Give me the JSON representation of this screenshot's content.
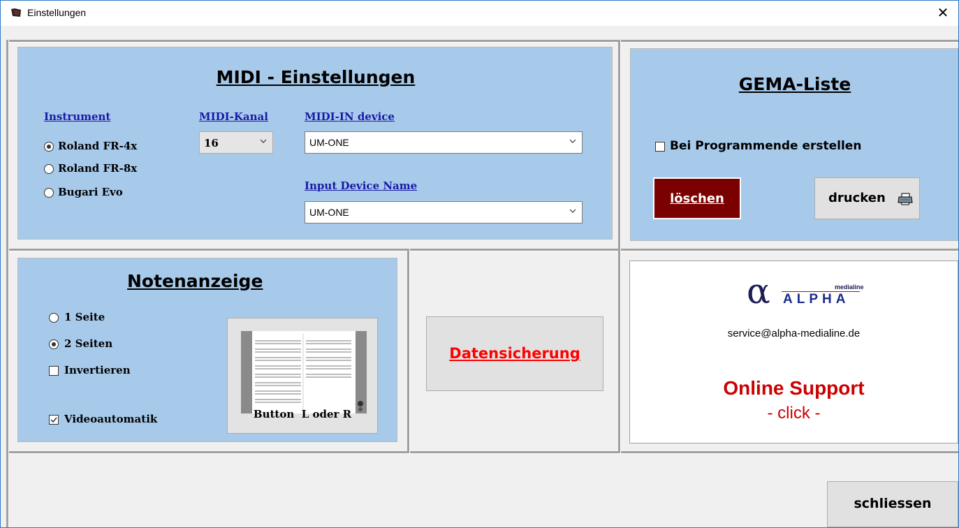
{
  "window": {
    "title": "Einstellungen",
    "close_glyph": "✕"
  },
  "midi": {
    "title": "MIDI - Einstellungen",
    "instrument_label": "Instrument",
    "instruments": [
      {
        "label": "Roland FR-4x",
        "selected": true
      },
      {
        "label": "Roland FR-8x",
        "selected": false
      },
      {
        "label": "Bugari Evo",
        "selected": false
      }
    ],
    "kanal_label": "MIDI-Kanal",
    "kanal_value": "16",
    "in_device_label": "MIDI-IN device",
    "in_device_value": "UM-ONE",
    "input_name_label": "Input Device Name",
    "input_name_value": "UM-ONE"
  },
  "gema": {
    "title": "GEMA-Liste",
    "checkbox_label": "Bei Programmende erstellen",
    "checkbox_checked": false,
    "delete_label": "löschen",
    "print_label": "drucken",
    "print_icon": "printer-icon"
  },
  "noten": {
    "title": "Notenanzeige",
    "options": [
      {
        "label": "1 Seite",
        "selected": false
      },
      {
        "label": "2 Seiten",
        "selected": true
      }
    ],
    "invert_label": "Invertieren",
    "invert_checked": false,
    "video_label": "Videoautomatik",
    "video_checked": true,
    "preview_caption": "Button  L oder R"
  },
  "backup": {
    "label": "Datensicherung"
  },
  "support": {
    "logo_alpha": "α",
    "logo_brand": "ALPHA",
    "logo_small": "medialine",
    "email": "service@alpha-medialine.de",
    "headline": "Online Support",
    "click": "- click -"
  },
  "footer": {
    "close_label": "schliessen"
  },
  "colors": {
    "panel_blue": "#a7caeb",
    "delete_bg": "#7b0000",
    "backup_red": "#ff0000",
    "support_red": "#cc0000",
    "link_blue": "#1a1aa6"
  }
}
